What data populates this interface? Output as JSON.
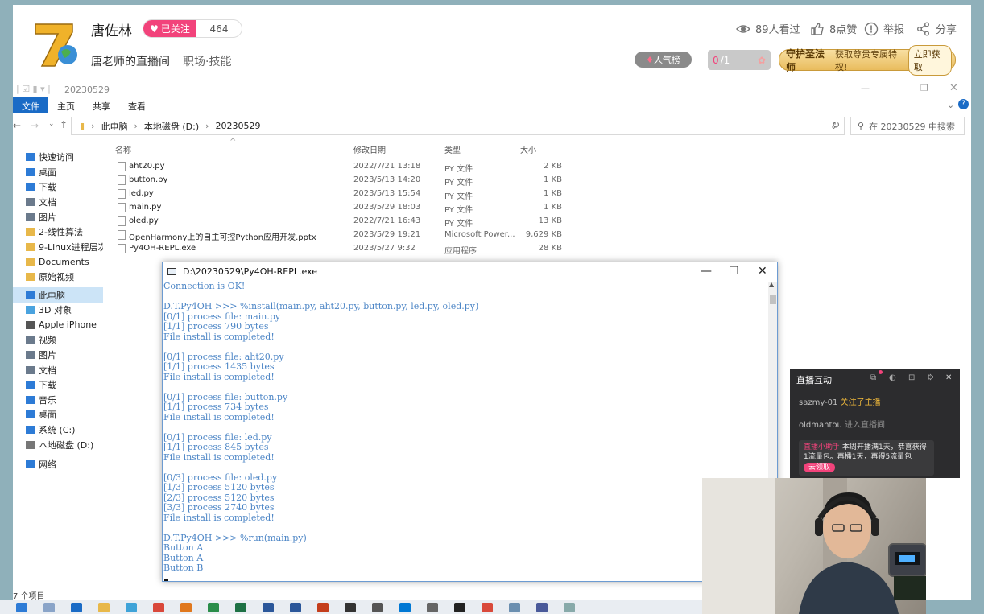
{
  "stream": {
    "streamer_name": "唐佐林",
    "follow_label": "已关注",
    "follower_count": "464",
    "room_name": "唐老师的直播间",
    "room_category": "职场·技能",
    "viewers": "89人看过",
    "likes": "8点赞",
    "report": "举报",
    "share": "分享",
    "popularity_label": "人气榜",
    "gift_count_current": "0",
    "gift_count_total": "/1",
    "guard_title": "守护圣法师",
    "guard_desc": "获取尊贵专属特权!",
    "guard_button": "立即获取",
    "colors": {
      "accent": "#f2437b",
      "gold": "#e9bc5d"
    }
  },
  "explorer": {
    "title": "20230529",
    "ribbon_tabs": [
      "文件",
      "主页",
      "共享",
      "查看"
    ],
    "breadcrumb": [
      "此电脑",
      "本地磁盘 (D:)",
      "20230529"
    ],
    "search_placeholder": "在 20230529 中搜索",
    "nav_items": [
      {
        "label": "快速访问",
        "icon": "star-icon",
        "color": "#2d7bd6"
      },
      {
        "label": "桌面",
        "icon": "desktop-icon",
        "color": "#2d7bd6"
      },
      {
        "label": "下载",
        "icon": "download-icon",
        "color": "#2d7bd6"
      },
      {
        "label": "文档",
        "icon": "document-icon",
        "color": "#6b7a8c"
      },
      {
        "label": "图片",
        "icon": "pictures-icon",
        "color": "#6b7a8c"
      },
      {
        "label": "2-线性算法",
        "icon": "folder-icon",
        "color": "#e8b84a"
      },
      {
        "label": "9-Linux进程层次分",
        "icon": "folder-icon",
        "color": "#e8b84a"
      },
      {
        "label": "Documents",
        "icon": "folder-icon",
        "color": "#e8b84a"
      },
      {
        "label": "原始视频",
        "icon": "folder-icon",
        "color": "#e8b84a"
      },
      {
        "label": "此电脑",
        "icon": "computer-icon",
        "color": "#2d7bd6"
      },
      {
        "label": "3D 对象",
        "icon": "3d-objects-icon",
        "color": "#4aa3df"
      },
      {
        "label": "Apple iPhone",
        "icon": "phone-icon",
        "color": "#555555"
      },
      {
        "label": "视频",
        "icon": "video-icon",
        "color": "#6b7a8c"
      },
      {
        "label": "图片",
        "icon": "pictures-icon",
        "color": "#6b7a8c"
      },
      {
        "label": "文档",
        "icon": "document-icon",
        "color": "#6b7a8c"
      },
      {
        "label": "下载",
        "icon": "download-icon",
        "color": "#2d7bd6"
      },
      {
        "label": "音乐",
        "icon": "music-icon",
        "color": "#2d7bd6"
      },
      {
        "label": "桌面",
        "icon": "desktop-icon",
        "color": "#2d7bd6"
      },
      {
        "label": "系统 (C:)",
        "icon": "drive-icon",
        "color": "#2d7bd6"
      },
      {
        "label": "本地磁盘 (D:)",
        "icon": "drive-icon",
        "color": "#777777"
      },
      {
        "label": "网络",
        "icon": "network-icon",
        "color": "#2d7bd6"
      }
    ],
    "columns": {
      "name": "名称",
      "date": "修改日期",
      "type": "类型",
      "size": "大小"
    },
    "files": [
      {
        "name": "aht20.py",
        "date": "2022/7/21 13:18",
        "type": "PY 文件",
        "size": "2 KB"
      },
      {
        "name": "button.py",
        "date": "2023/5/13 14:20",
        "type": "PY 文件",
        "size": "1 KB"
      },
      {
        "name": "led.py",
        "date": "2023/5/13 15:54",
        "type": "PY 文件",
        "size": "1 KB"
      },
      {
        "name": "main.py",
        "date": "2023/5/29 18:03",
        "type": "PY 文件",
        "size": "1 KB"
      },
      {
        "name": "oled.py",
        "date": "2022/7/21 16:43",
        "type": "PY 文件",
        "size": "13 KB"
      },
      {
        "name": "OpenHarmony上的自主可控Python应用开发.pptx",
        "date": "2023/5/29 19:21",
        "type": "Microsoft Power...",
        "size": "9,629 KB"
      },
      {
        "name": "Py4OH-REPL.exe",
        "date": "2023/5/27 9:32",
        "type": "应用程序",
        "size": "28 KB"
      }
    ],
    "status": "7 个项目"
  },
  "console": {
    "title": "D:\\20230529\\Py4OH-REPL.exe",
    "lines": [
      "Connection is OK!",
      "",
      "D.T.Py4OH >>> %install(main.py, aht20.py, button.py, led.py, oled.py)",
      "[0/1] process file: main.py",
      "[1/1] process 790 bytes",
      "File install is completed!",
      "",
      "[0/1] process file: aht20.py",
      "[1/1] process 1435 bytes",
      "File install is completed!",
      "",
      "[0/1] process file: button.py",
      "[1/1] process 734 bytes",
      "File install is completed!",
      "",
      "[0/1] process file: led.py",
      "[1/1] process 845 bytes",
      "File install is completed!",
      "",
      "[0/3] process file: oled.py",
      "[1/3] process 5120 bytes",
      "[2/3] process 5120 bytes",
      "[3/3] process 2740 bytes",
      "File install is completed!",
      "",
      "D.T.Py4OH >>> %run(main.py)",
      "Button A",
      "Button A",
      "Button B"
    ]
  },
  "live_panel": {
    "title": "直播互动",
    "msg1_user": "sazmy-01",
    "msg1_text": "关注了主播",
    "msg2_user": "oldmantou",
    "msg2_text": "进入直播间",
    "assistant_name": "直播小助手:",
    "assistant_text": "本周开播满1天，恭喜获得1流量包。再播1天，再得5流量包",
    "claim_button": "去领取"
  }
}
